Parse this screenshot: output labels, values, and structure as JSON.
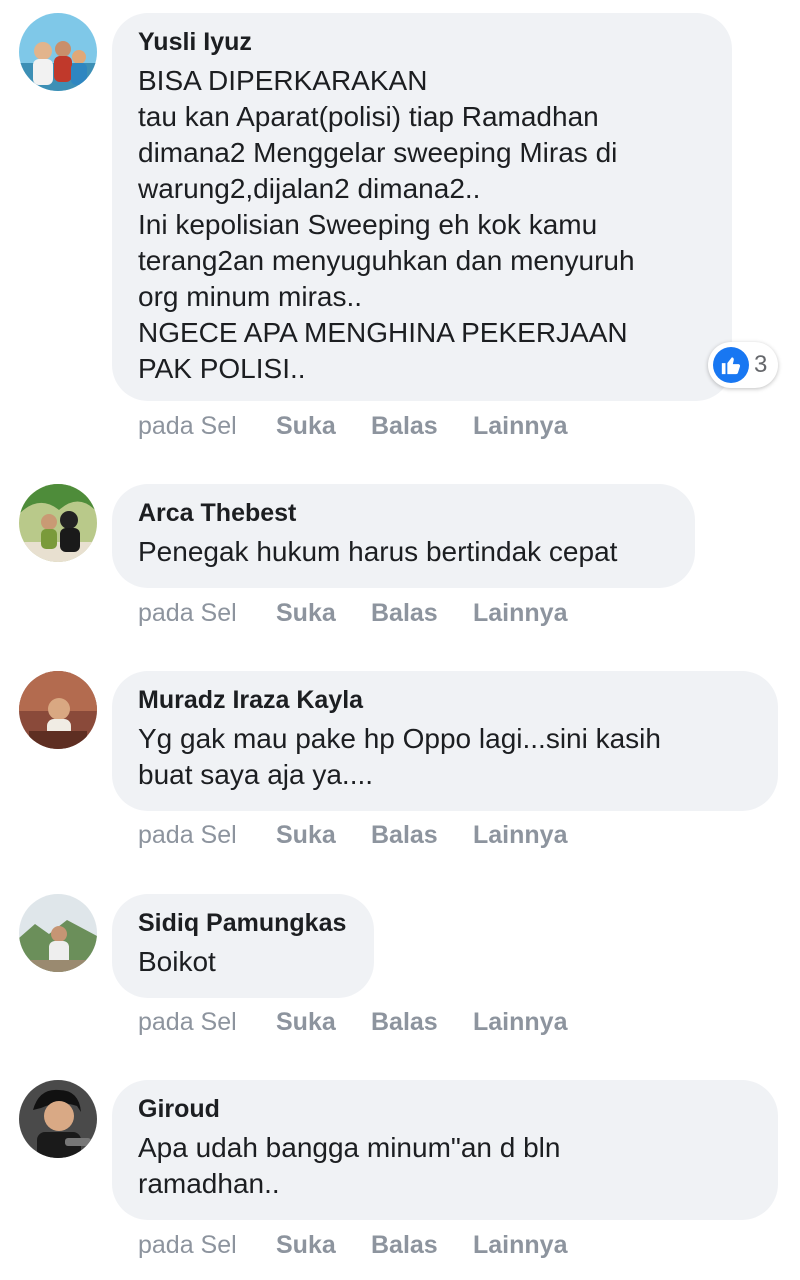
{
  "colors": {
    "bubble": "#f0f2f5",
    "text": "#1c1e21",
    "meta": "#8d949e",
    "like_blue": "#1877f2"
  },
  "comments": [
    {
      "author": "Yusli Iyuz",
      "text": "BISA DIPERKARAKAN\ntau kan Aparat(polisi) tiap Ramadhan\ndimana2 Menggelar sweeping Miras di\nwarung2,dijalan2 dimana2..\nIni kepolisian Sweeping eh kok kamu\nterang2an menyuguhkan dan menyuruh\norg minum miras..\nNGECE APA MENGHINA PEKERJAAN\nPAK POLISI..",
      "time": "pada Sel",
      "like": "Suka",
      "reply": "Balas",
      "more": "Lainnya",
      "reactions": {
        "icon": "like-icon",
        "count": "3"
      }
    },
    {
      "author": "Arca Thebest",
      "text": "Penegak hukum harus bertindak cepat",
      "time": "pada Sel",
      "like": "Suka",
      "reply": "Balas",
      "more": "Lainnya"
    },
    {
      "author": "Muradz Iraza Kayla",
      "text": "Yg gak mau pake hp Oppo lagi...sini kasih\nbuat saya aja ya....",
      "time": "pada Sel",
      "like": "Suka",
      "reply": "Balas",
      "more": "Lainnya"
    },
    {
      "author": "Sidiq Pamungkas",
      "text": "Boikot",
      "time": "pada Sel",
      "like": "Suka",
      "reply": "Balas",
      "more": "Lainnya"
    },
    {
      "author": "Giroud",
      "text": "Apa udah bangga minum\"an d bln\nramadhan..",
      "time": "pada Sel",
      "like": "Suka",
      "reply": "Balas",
      "more": "Lainnya"
    }
  ]
}
